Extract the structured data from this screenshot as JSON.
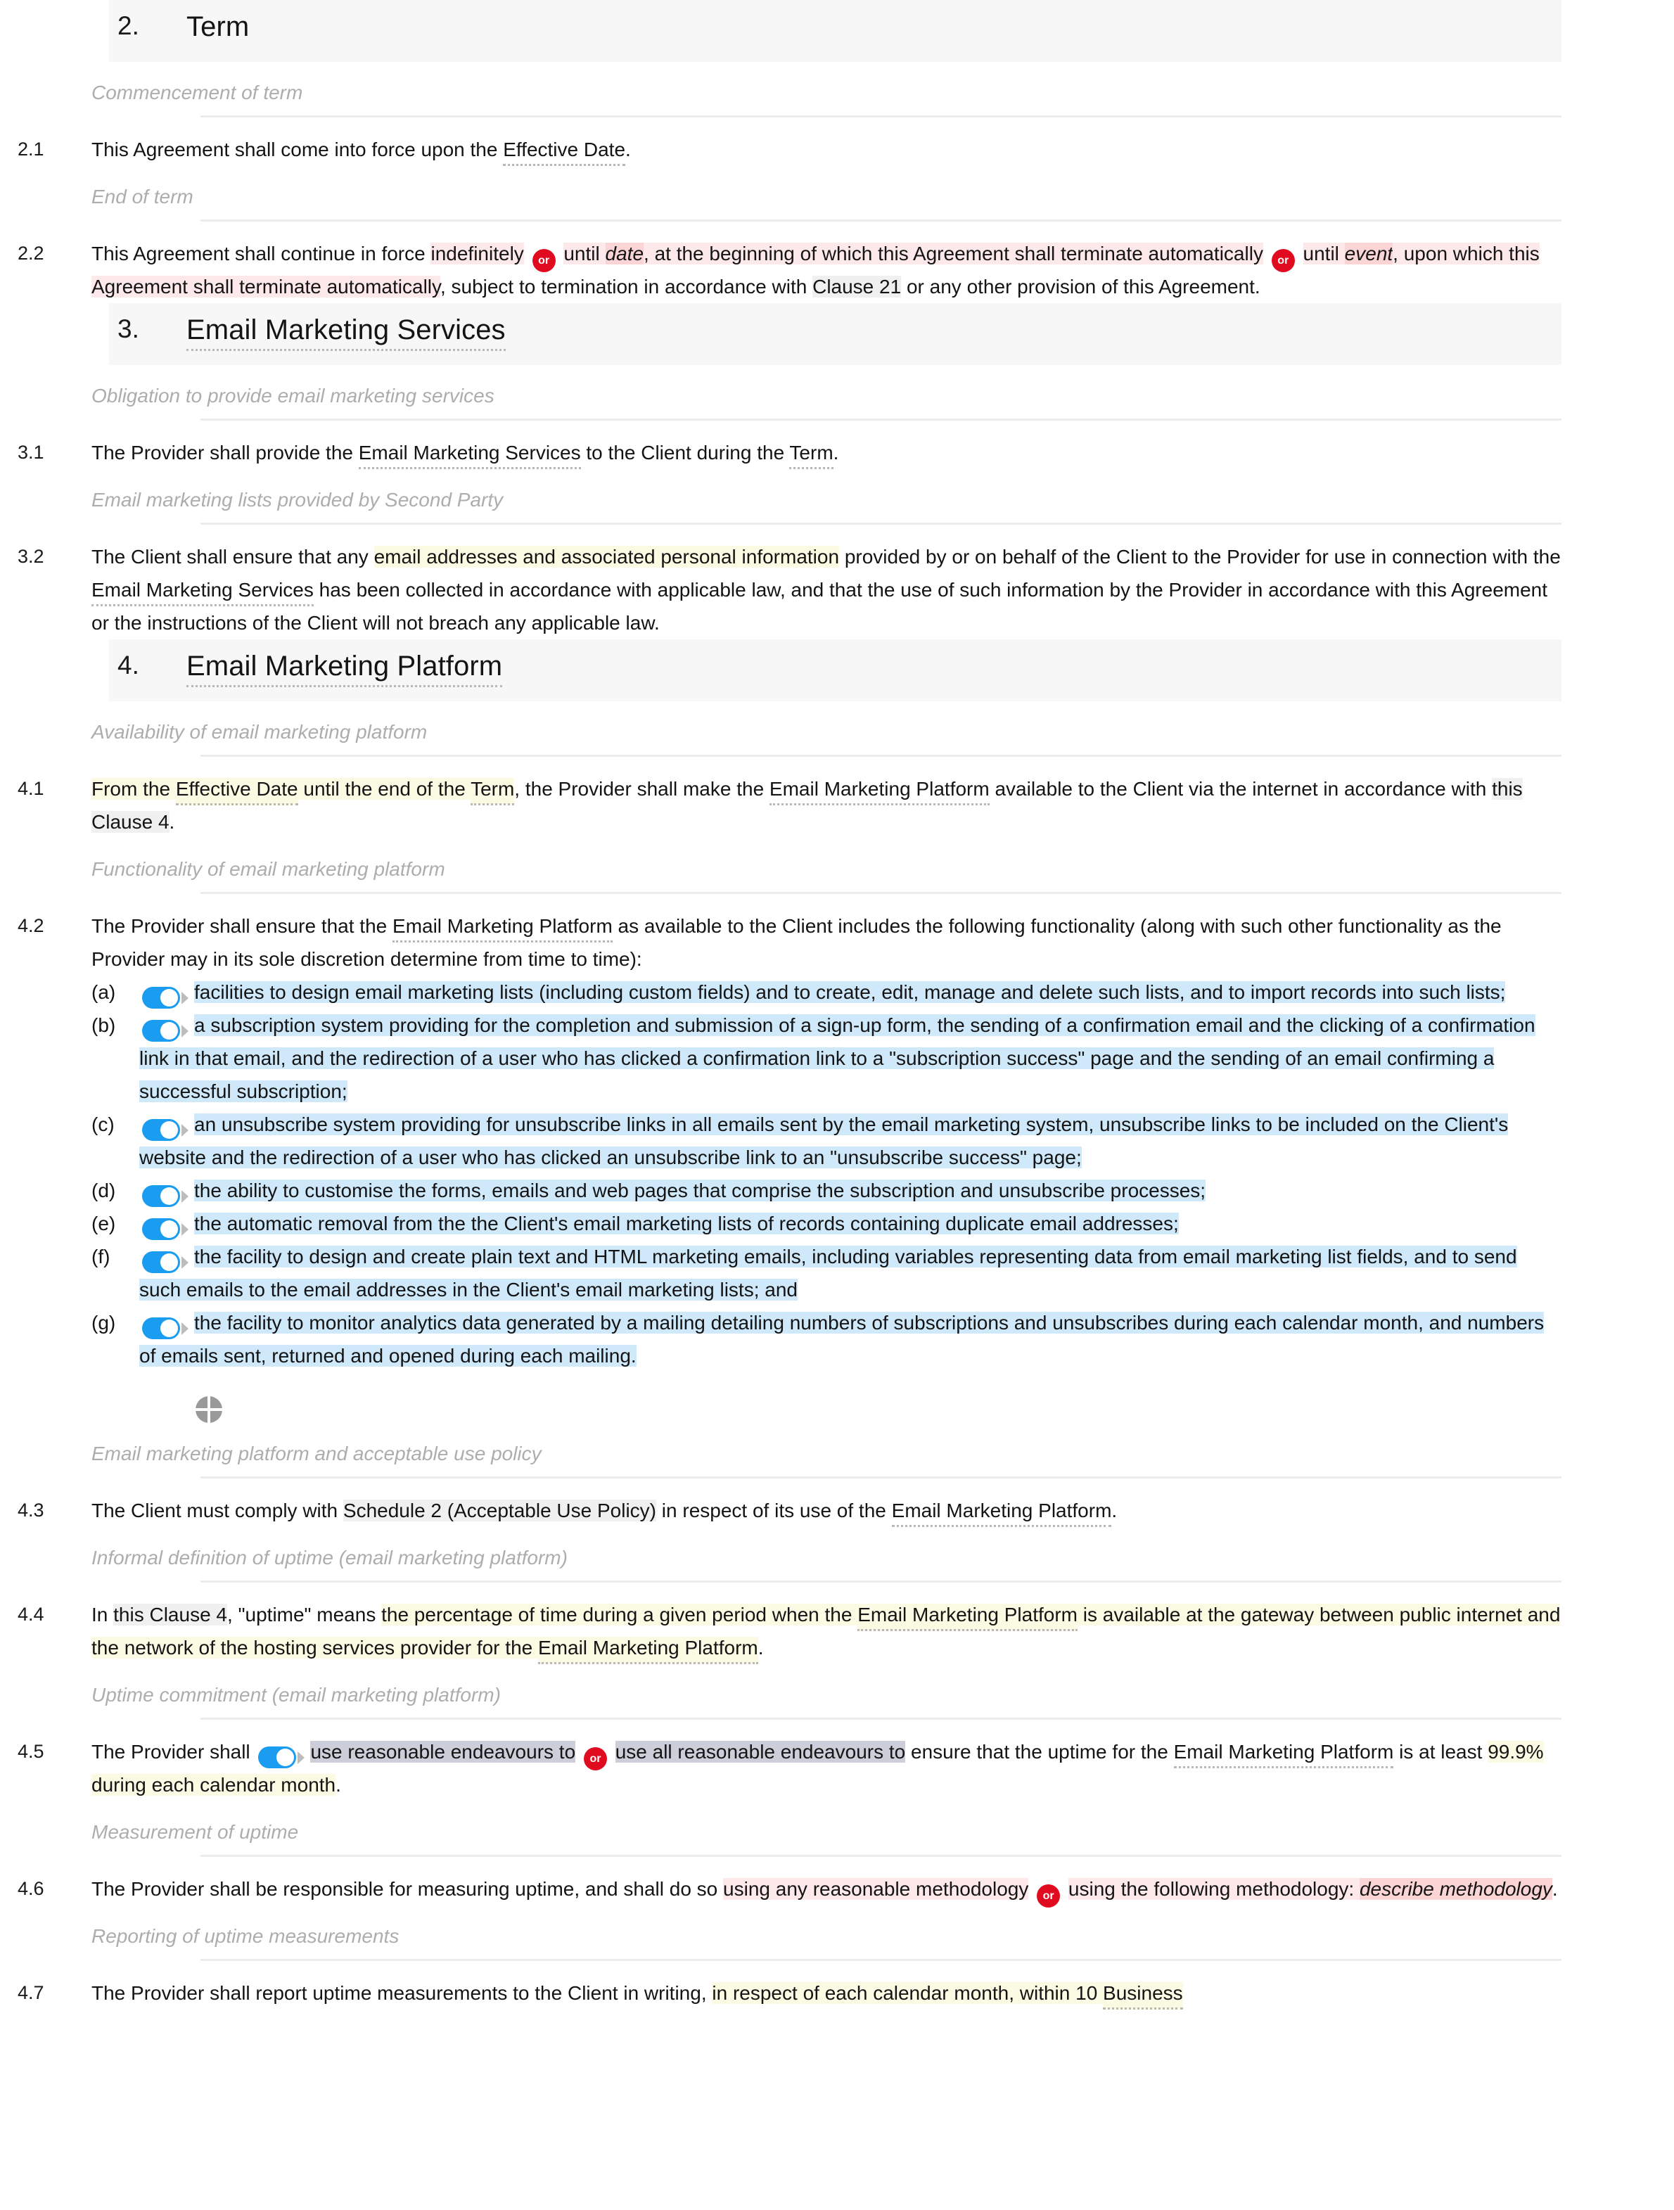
{
  "document": {
    "type": "legal-contract-editor",
    "accent_or_badge_color": "#e00b1f",
    "toggle_on_color": "#1a9cf0"
  },
  "sections": [
    {
      "number": "2.",
      "title": "Term",
      "title_is_defined_term": false,
      "groups": [
        {
          "heading": "Commencement of term",
          "clauses": [
            {
              "number": "2.1",
              "runs": [
                {
                  "text": "This Agreement shall come into force upon the ",
                  "style": "plain"
                },
                {
                  "text": "Effective Date",
                  "style": "defterm"
                },
                {
                  "text": ".",
                  "style": "plain"
                }
              ]
            }
          ]
        },
        {
          "heading": "End of term",
          "clauses": [
            {
              "number": "2.2",
              "runs": [
                {
                  "text": "This Agreement shall continue in force ",
                  "style": "plain"
                },
                {
                  "text": "indefinitely",
                  "style": "pink"
                },
                {
                  "text": " ",
                  "style": "plain"
                },
                {
                  "text": "or",
                  "style": "or-badge"
                },
                {
                  "text": " ",
                  "style": "plain"
                },
                {
                  "text": "until ",
                  "style": "pink"
                },
                {
                  "text": "date",
                  "style": "pink-dark-italic"
                },
                {
                  "text": ", at the beginning of which this Agreement shall terminate automatically",
                  "style": "pink"
                },
                {
                  "text": " ",
                  "style": "plain"
                },
                {
                  "text": "or",
                  "style": "or-badge"
                },
                {
                  "text": " ",
                  "style": "plain"
                },
                {
                  "text": "until ",
                  "style": "pink"
                },
                {
                  "text": "event",
                  "style": "pink-dark-italic"
                },
                {
                  "text": ", upon which this Agreement shall terminate automatically",
                  "style": "pink"
                },
                {
                  "text": ", subject to termination in accordance with ",
                  "style": "plain"
                },
                {
                  "text": "Clause 21",
                  "style": "gray"
                },
                {
                  "text": " or any other provision of this Agreement.",
                  "style": "plain"
                }
              ]
            }
          ]
        }
      ]
    },
    {
      "number": "3.",
      "title": "Email Marketing Services",
      "title_is_defined_term": true,
      "groups": [
        {
          "heading": "Obligation to provide email marketing services",
          "clauses": [
            {
              "number": "3.1",
              "runs": [
                {
                  "text": "The Provider shall provide the ",
                  "style": "plain"
                },
                {
                  "text": "Email Marketing Services",
                  "style": "defterm"
                },
                {
                  "text": " to the Client during the ",
                  "style": "plain"
                },
                {
                  "text": "Term",
                  "style": "defterm"
                },
                {
                  "text": ".",
                  "style": "plain"
                }
              ]
            }
          ]
        },
        {
          "heading": "Email marketing lists provided by Second Party",
          "clauses": [
            {
              "number": "3.2",
              "runs": [
                {
                  "text": "The Client shall ensure that any ",
                  "style": "plain"
                },
                {
                  "text": "email addresses and associated personal information",
                  "style": "yellow"
                },
                {
                  "text": " provided by or on behalf of the Client to the Provider for use in connection with the ",
                  "style": "plain"
                },
                {
                  "text": "Email Marketing Services",
                  "style": "defterm"
                },
                {
                  "text": " has been collected in accordance with applicable law, and that the use of such information by the Provider in accordance with this Agreement or the instructions of the Client will not breach any applicable law.",
                  "style": "plain"
                }
              ]
            }
          ]
        }
      ]
    },
    {
      "number": "4.",
      "title": "Email Marketing Platform",
      "title_is_defined_term": true,
      "groups": [
        {
          "heading": "Availability of email marketing platform",
          "clauses": [
            {
              "number": "4.1",
              "runs": [
                {
                  "text": "From the ",
                  "style": "yellow"
                },
                {
                  "text": "Effective Date",
                  "style": "yellow-defterm"
                },
                {
                  "text": " until the end of the ",
                  "style": "yellow"
                },
                {
                  "text": "Term",
                  "style": "yellow-defterm"
                },
                {
                  "text": ", the Provider shall make the ",
                  "style": "plain"
                },
                {
                  "text": "Email Marketing Platform",
                  "style": "defterm"
                },
                {
                  "text": " available to the Client via the internet in accordance with ",
                  "style": "plain"
                },
                {
                  "text": "this Clause 4",
                  "style": "gray"
                },
                {
                  "text": ".",
                  "style": "plain"
                }
              ]
            }
          ]
        },
        {
          "heading": "Functionality of email marketing platform",
          "clauses": [
            {
              "number": "4.2",
              "runs": [
                {
                  "text": "The Provider shall ensure that the ",
                  "style": "plain"
                },
                {
                  "text": "Email Marketing Platform",
                  "style": "defterm"
                },
                {
                  "text": " as available to the Client includes the following functionality (along with such other functionality as the Provider may in its sole discretion determine from time to time):",
                  "style": "plain"
                }
              ],
              "sublist": [
                {
                  "label": "(a)",
                  "toggle": true,
                  "toggle_state": "on",
                  "text": "facilities to design email marketing lists (including custom fields) and to create, edit, manage and delete such lists, and to import records into such lists;",
                  "highlight": "blue"
                },
                {
                  "label": "(b)",
                  "toggle": true,
                  "toggle_state": "on",
                  "text": "a subscription system providing for the completion and submission of a sign-up form, the sending of a confirmation email and the clicking of a confirmation link in that email, and the redirection of a user who has clicked a confirmation link to a \"subscription success\" page and the sending of an email confirming a successful subscription;",
                  "highlight": "blue"
                },
                {
                  "label": "(c)",
                  "toggle": true,
                  "toggle_state": "on",
                  "text": "an unsubscribe system providing for unsubscribe links in all emails sent by the email marketing system, unsubscribe links to be included on the Client's website and the redirection of a user who has clicked an unsubscribe link to an \"unsubscribe success\" page;",
                  "highlight": "blue"
                },
                {
                  "label": "(d)",
                  "toggle": true,
                  "toggle_state": "on",
                  "text": "the ability to customise the forms, emails and web pages that comprise the subscription and unsubscribe processes;",
                  "highlight": "blue"
                },
                {
                  "label": "(e)",
                  "toggle": true,
                  "toggle_state": "on",
                  "text": "the automatic removal from the the Client's email marketing lists of records containing duplicate email addresses;",
                  "highlight": "blue"
                },
                {
                  "label": "(f)",
                  "toggle": true,
                  "toggle_state": "on",
                  "text": "the facility to design and create plain text and HTML marketing emails, including variables representing data from email marketing list fields, and to send such emails to the email addresses in the Client's email marketing lists; and",
                  "highlight": "blue"
                },
                {
                  "label": "(g)",
                  "toggle": true,
                  "toggle_state": "on",
                  "text": "the facility to monitor analytics data generated by a mailing detailing numbers of subscriptions and unsubscribes during each calendar month, and numbers of emails sent, returned and opened during each mailing.",
                  "highlight": "blue"
                }
              ],
              "after_icon": "quadrant-circle-icon"
            }
          ]
        },
        {
          "heading": "Email marketing platform and acceptable use policy",
          "clauses": [
            {
              "number": "4.3",
              "runs": [
                {
                  "text": "The Client must comply with ",
                  "style": "plain"
                },
                {
                  "text": "Schedule 2 (Acceptable Use Policy)",
                  "style": "gray"
                },
                {
                  "text": " in respect of its use of the ",
                  "style": "plain"
                },
                {
                  "text": "Email Marketing Platform",
                  "style": "defterm"
                },
                {
                  "text": ".",
                  "style": "plain"
                }
              ]
            }
          ]
        },
        {
          "heading": "Informal definition of uptime (email marketing platform)",
          "clauses": [
            {
              "number": "4.4",
              "runs": [
                {
                  "text": "In ",
                  "style": "plain"
                },
                {
                  "text": "this Clause 4",
                  "style": "gray"
                },
                {
                  "text": ", \"uptime\" means ",
                  "style": "plain"
                },
                {
                  "text": "the percentage of time during a given period when the ",
                  "style": "yellow"
                },
                {
                  "text": "Email Marketing Platform",
                  "style": "yellow-defterm"
                },
                {
                  "text": " is available at the gateway between public internet and the network of the hosting services provider for the ",
                  "style": "yellow"
                },
                {
                  "text": "Email Marketing Platform",
                  "style": "yellow-defterm"
                },
                {
                  "text": ".",
                  "style": "plain"
                }
              ]
            }
          ]
        },
        {
          "heading": "Uptime commitment (email marketing platform)",
          "clauses": [
            {
              "number": "4.5",
              "runs": [
                {
                  "text": "The Provider shall ",
                  "style": "plain"
                },
                {
                  "text": "",
                  "style": "toggle-on"
                },
                {
                  "text": "use reasonable endeavours to",
                  "style": "lavender"
                },
                {
                  "text": " ",
                  "style": "plain"
                },
                {
                  "text": "or",
                  "style": "or-badge"
                },
                {
                  "text": " ",
                  "style": "plain"
                },
                {
                  "text": "use all reasonable endeavours to",
                  "style": "lavender"
                },
                {
                  "text": " ensure that the uptime for the ",
                  "style": "plain"
                },
                {
                  "text": "Email Marketing Platform",
                  "style": "defterm"
                },
                {
                  "text": " is at least ",
                  "style": "plain"
                },
                {
                  "text": "99.9% during each calendar month",
                  "style": "yellow"
                },
                {
                  "text": ".",
                  "style": "plain"
                }
              ]
            }
          ]
        },
        {
          "heading": "Measurement of uptime",
          "clauses": [
            {
              "number": "4.6",
              "runs": [
                {
                  "text": "The Provider shall be responsible for measuring uptime, and shall do so ",
                  "style": "plain"
                },
                {
                  "text": "using any reasonable methodology",
                  "style": "pink"
                },
                {
                  "text": " ",
                  "style": "plain"
                },
                {
                  "text": "or",
                  "style": "or-badge"
                },
                {
                  "text": " ",
                  "style": "plain"
                },
                {
                  "text": "using the following methodology: ",
                  "style": "pink"
                },
                {
                  "text": "describe methodology",
                  "style": "pink-dark-italic"
                },
                {
                  "text": ".",
                  "style": "plain"
                }
              ]
            }
          ]
        },
        {
          "heading": "Reporting of uptime measurements",
          "clauses": [
            {
              "number": "4.7",
              "runs": [
                {
                  "text": "The Provider shall report uptime measurements to the Client in writing, ",
                  "style": "plain"
                },
                {
                  "text": "in respect of each calendar month, within 10 ",
                  "style": "yellow"
                },
                {
                  "text": "Business",
                  "style": "yellow-defterm"
                }
              ]
            }
          ]
        }
      ]
    }
  ]
}
